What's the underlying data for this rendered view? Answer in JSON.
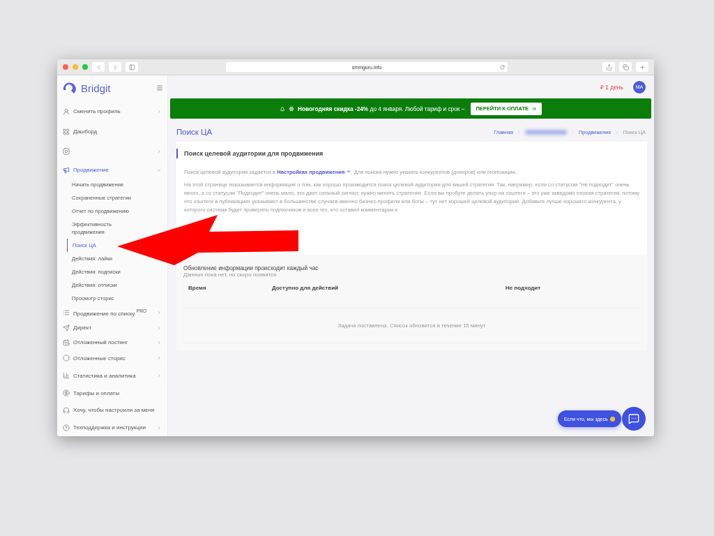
{
  "browser": {
    "url": "smmguru.info"
  },
  "brand": {
    "name": "Bridgit"
  },
  "topbar": {
    "balance": "₽ 1 день",
    "avatar": "MA"
  },
  "sidebar": {
    "items": [
      {
        "label": "Сменить профиль",
        "chevron": true,
        "expanded": false,
        "selected": false
      },
      {
        "label": "Дашборд",
        "chevron": false,
        "expanded": false,
        "selected": false
      },
      {
        "chevron": true,
        "expanded": false,
        "selected": false
      },
      {
        "label": "Продвижение",
        "chevron": true,
        "expanded": true,
        "selected": true,
        "children": [
          {
            "label": "Начать продвижение",
            "selected": false
          },
          {
            "label": "Сохраненные стратегии",
            "selected": false
          },
          {
            "label": "Отчет по продвижению",
            "selected": false
          },
          {
            "label": "Эффективность продвижения",
            "selected": false
          },
          {
            "label": "Поиск ЦА",
            "selected": true
          },
          {
            "label": "Действия: лайки",
            "selected": false
          },
          {
            "label": "Действия: подписки",
            "selected": false
          },
          {
            "label": "Действия: отписки",
            "selected": false
          },
          {
            "label": "Просмотр сторис",
            "selected": false
          }
        ]
      },
      {
        "label": "Продвижение по списку $^{PRO}$",
        "chevron": true,
        "expanded": false,
        "selected": false
      },
      {
        "label": "Директ",
        "chevron": true,
        "expanded": false,
        "selected": false
      },
      {
        "label": "Отложенный постинг",
        "chevron": true,
        "expanded": false,
        "selected": false
      },
      {
        "label": "Отложенные сторис",
        "chevron": true,
        "expanded": false,
        "selected": false
      },
      {
        "label": "Статистика и аналитика",
        "chevron": true,
        "expanded": false,
        "selected": false
      },
      {
        "label": "Тарифы и оплаты",
        "chevron": false,
        "expanded": false,
        "selected": false
      },
      {
        "label": "Хочу, чтобы настроили за меня",
        "chevron": false,
        "expanded": false,
        "selected": false
      },
      {
        "label": "Техподдержка и инструкции",
        "chevron": true,
        "expanded": false,
        "selected": false
      }
    ]
  },
  "banner": {
    "text": "**Новогодняя скидка -24%** до 4 января. Любой тариф и срок –",
    "button": "ПЕРЕЙТИ К ОПЛАТЕ"
  },
  "page_title": "Поиск ЦА",
  "breadcrumbs": [
    {
      "kind": "link",
      "label": "Главная"
    },
    {
      "kind": "blurred"
    },
    {
      "kind": "link",
      "label": "Продвижение"
    },
    {
      "kind": "current",
      "label": "Поиск ЦА"
    }
  ],
  "info_card": {
    "title": "Поиск целевой аудитории для продвижения",
    "intro": {
      "before": "Поиск целевой аудитории задается в ",
      "link": "Настройках продвижения",
      "after": ". Для поиска нужно указать конкурентов (доноров) или геопозиции."
    },
    "body": "На этой странице показывается информация о том, как хорошо производится поиск целевой аудитории для вашей стратегии. Так, например, если со статусом \"Не подходит\" очень много, а со статусом \"Подходит\" очень мало, это дает сильный сигнал: нужно менять стратегию. Если вы пробуте делать упор на хэштеги – это уже заведомо плохая стратегия, потому что хэштеги в публикациях указывают в большинстве случаев именно бизнес-профили или боты – тут нет хорошей целевой аудитории. Добавьте лучше хорошего конкурента, у которого система будет проверять подписчиков и всех тех, кто оставил комментарии к"
  },
  "results": {
    "title": "Обновление информации происходит каждый час",
    "subtitle": "Данных пока нет, но скоро появятся",
    "table": {
      "columns": [
        "Время",
        "Доступно для действий",
        "Не подходит"
      ],
      "empty_message": "Задача поставлена. Список обновится в течение 15 минут"
    }
  },
  "chat": {
    "label": "Если что, мы здесь"
  }
}
